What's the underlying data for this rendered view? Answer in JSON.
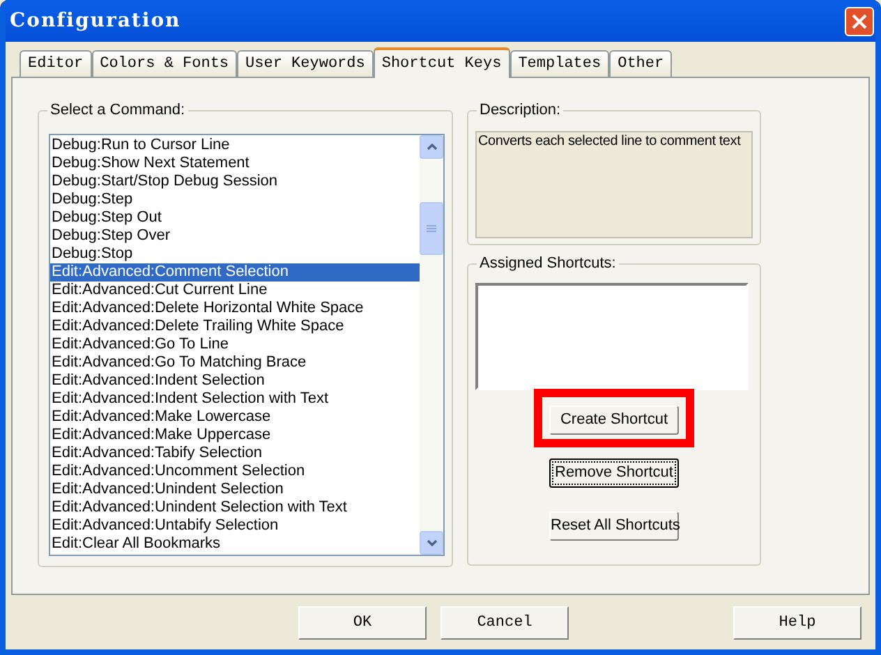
{
  "window": {
    "title": "Configuration"
  },
  "tabs": [
    {
      "label": "Editor",
      "selected": false
    },
    {
      "label": "Colors & Fonts",
      "selected": false
    },
    {
      "label": "User Keywords",
      "selected": false
    },
    {
      "label": "Shortcut Keys",
      "selected": true
    },
    {
      "label": "Templates",
      "selected": false
    },
    {
      "label": "Other",
      "selected": false
    }
  ],
  "commands": {
    "label": "Select a Command:",
    "items": [
      {
        "text": "Debug:Run to Cursor Line",
        "selected": false
      },
      {
        "text": "Debug:Show Next Statement",
        "selected": false
      },
      {
        "text": "Debug:Start/Stop Debug Session",
        "selected": false
      },
      {
        "text": "Debug:Step",
        "selected": false
      },
      {
        "text": "Debug:Step Out",
        "selected": false
      },
      {
        "text": "Debug:Step Over",
        "selected": false
      },
      {
        "text": "Debug:Stop",
        "selected": false
      },
      {
        "text": "Edit:Advanced:Comment Selection",
        "selected": true
      },
      {
        "text": "Edit:Advanced:Cut Current Line",
        "selected": false
      },
      {
        "text": "Edit:Advanced:Delete Horizontal White Space",
        "selected": false
      },
      {
        "text": "Edit:Advanced:Delete Trailing White Space",
        "selected": false
      },
      {
        "text": "Edit:Advanced:Go To Line",
        "selected": false
      },
      {
        "text": "Edit:Advanced:Go To Matching Brace",
        "selected": false
      },
      {
        "text": "Edit:Advanced:Indent Selection",
        "selected": false
      },
      {
        "text": "Edit:Advanced:Indent Selection with Text",
        "selected": false
      },
      {
        "text": "Edit:Advanced:Make Lowercase",
        "selected": false
      },
      {
        "text": "Edit:Advanced:Make Uppercase",
        "selected": false
      },
      {
        "text": "Edit:Advanced:Tabify Selection",
        "selected": false
      },
      {
        "text": "Edit:Advanced:Uncomment Selection",
        "selected": false
      },
      {
        "text": "Edit:Advanced:Unindent Selection",
        "selected": false
      },
      {
        "text": "Edit:Advanced:Unindent Selection with Text",
        "selected": false
      },
      {
        "text": "Edit:Advanced:Untabify Selection",
        "selected": false
      },
      {
        "text": "Edit:Clear All Bookmarks",
        "selected": false
      }
    ]
  },
  "description": {
    "label": "Description:",
    "text": "Converts each selected line to comment text"
  },
  "assigned_shortcuts": {
    "label": "Assigned Shortcuts:"
  },
  "shortcut_buttons": [
    {
      "label": "Create Shortcut",
      "highlighted": true,
      "focused": false
    },
    {
      "label": "Remove Shortcut",
      "focused": true
    },
    {
      "label": "Reset All Shortcuts",
      "focused": false
    }
  ],
  "dialog_buttons": [
    {
      "label": "OK",
      "kind": "ok"
    },
    {
      "label": "Cancel",
      "kind": "cancel"
    },
    {
      "label": "Help",
      "kind": "help"
    }
  ]
}
